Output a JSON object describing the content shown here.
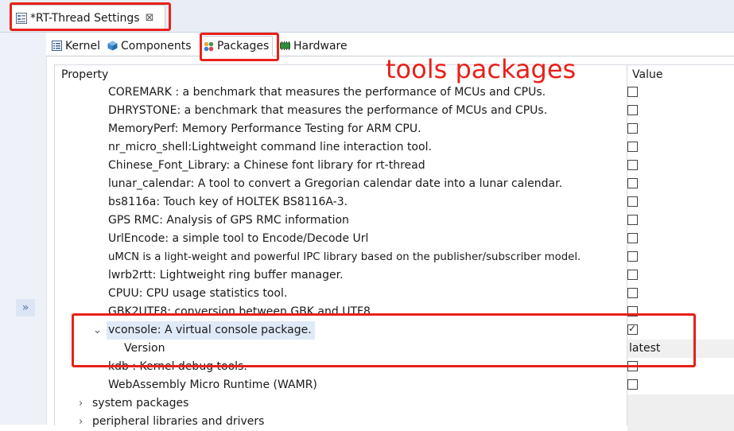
{
  "editor_tab": {
    "title": "*RT-Thread Settings",
    "close": "⊠"
  },
  "sub_tabs": [
    {
      "label": "Kernel",
      "icon": "list-icon"
    },
    {
      "label": "Components",
      "icon": "cube-icon"
    },
    {
      "label": "Packages",
      "icon": "packages-icon",
      "active": true
    },
    {
      "label": "Hardware",
      "icon": "chip-icon"
    }
  ],
  "gutter": {
    "expand": "»"
  },
  "annotation": {
    "text": "tools packages",
    "color": "#e8201a"
  },
  "tree": {
    "header_property": "Property",
    "header_value": "Value",
    "rows": [
      {
        "label": "COREMARK : a benchmark that measures the performance of MCUs and CPUs.",
        "checked": false
      },
      {
        "label": "DHRYSTONE: a benchmark that measures the performance of MCUs and CPUs.",
        "checked": false
      },
      {
        "label": "MemoryPerf: Memory Performance Testing for ARM CPU.",
        "checked": false
      },
      {
        "label": "nr_micro_shell:Lightweight command line interaction tool.",
        "checked": false
      },
      {
        "label": "Chinese_Font_Library: a Chinese font library for rt-thread",
        "checked": false
      },
      {
        "label": "lunar_calendar: A tool to convert a Gregorian calendar date into a lunar calendar.",
        "checked": false
      },
      {
        "label": "bs8116a: Touch key of HOLTEK BS8116A-3.",
        "checked": false
      },
      {
        "label": "GPS RMC: Analysis of GPS RMC information",
        "checked": false
      },
      {
        "label": "UrlEncode: a simple tool to Encode/Decode Url",
        "checked": false
      },
      {
        "label": "uMCN is a light-weight and powerful IPC library based on the publisher/subscriber model.",
        "checked": false
      },
      {
        "label": "lwrb2rtt: Lightweight ring buffer manager.",
        "checked": false
      },
      {
        "label": "CPUU: CPU usage statistics tool.",
        "checked": false
      },
      {
        "label": "GBK2UTF8: conversion between GBK and UTF8.",
        "checked": false
      },
      {
        "label": "vconsole: A virtual console package.",
        "checked": true
      },
      {
        "label": "Version",
        "value": "latest"
      },
      {
        "label": "kdb : Kernel debug tools.",
        "checked": false
      },
      {
        "label": "WebAssembly Micro Runtime (WAMR)",
        "checked": false
      }
    ],
    "groups": [
      {
        "label": "system packages"
      },
      {
        "label": "peripheral libraries and drivers"
      }
    ]
  }
}
